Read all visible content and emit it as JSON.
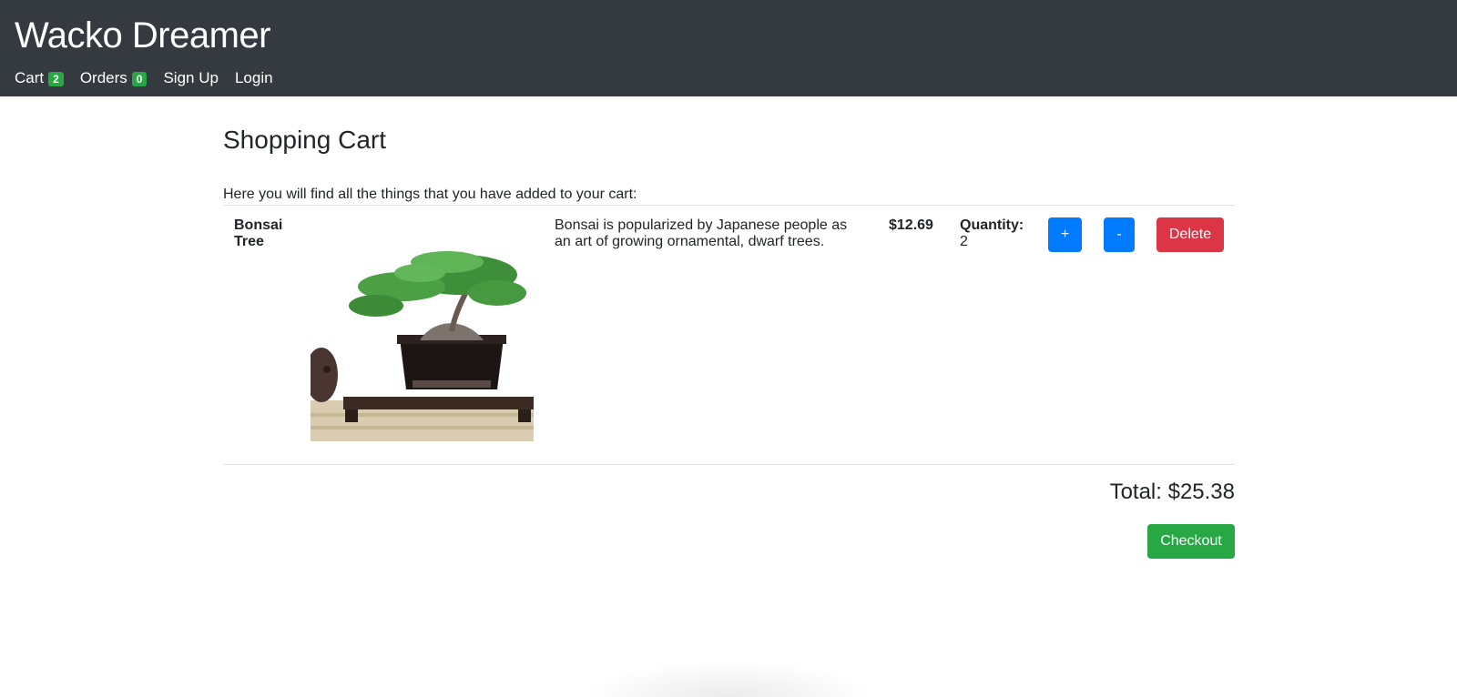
{
  "app": {
    "brand": "Wacko Dreamer"
  },
  "nav": {
    "cart_label": "Cart",
    "cart_count": "2",
    "orders_label": "Orders",
    "orders_count": "0",
    "signup_label": "Sign Up",
    "login_label": "Login"
  },
  "page": {
    "title": "Shopping Cart",
    "intro": "Here you will find all the things that you have added to your cart:"
  },
  "cart": {
    "items": [
      {
        "name": "Bonsai Tree",
        "description": "Bonsai is popularized by Japanese people as an art of growing ornamental, dwarf trees.",
        "price": "$12.69",
        "quantity_label": "Quantity:",
        "quantity": "2",
        "increment_label": "+",
        "decrement_label": "-",
        "delete_label": "Delete"
      }
    ],
    "total": "Total: $25.38",
    "checkout_label": "Checkout"
  },
  "colors": {
    "navbar": "#343a40",
    "badge": "#28a745",
    "primary": "#007bff",
    "danger": "#dc3545",
    "success": "#28a745"
  }
}
